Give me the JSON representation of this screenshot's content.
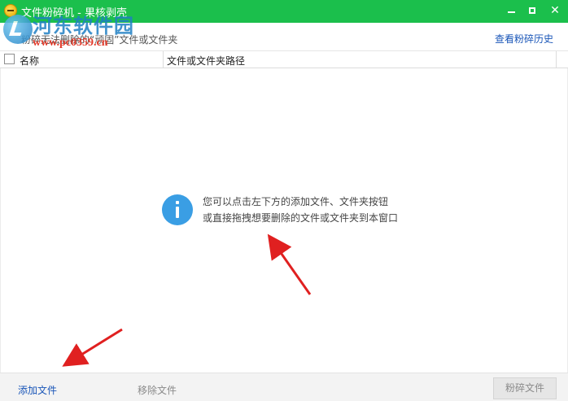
{
  "window": {
    "title": "文件粉碎机 - 果核剥壳"
  },
  "watermark": {
    "name": "河东软件园",
    "url": "www.pc0359.cn"
  },
  "infobar": {
    "text": "粉碎无法删除的“顽固”文件或文件夹",
    "history_link": "查看粉碎历史"
  },
  "table": {
    "columns": {
      "name": "名称",
      "path": "文件或文件夹路径"
    }
  },
  "hint": {
    "line1": "您可以点击左下方的添加文件、文件夹按钮",
    "line2": "或直接拖拽想要删除的文件或文件夹到本窗口"
  },
  "toolbar": {
    "add_file": "添加文件",
    "remove_file": "移除文件",
    "shred_file": "粉碎文件"
  },
  "colors": {
    "titlebar": "#1bbf4c",
    "link": "#1a56b8",
    "info_icon": "#3a9ee4",
    "annotation_arrow": "#e02020"
  },
  "icons": {
    "app": "app-logo-icon",
    "info": "info-icon",
    "minimize": "minimize-icon",
    "maximize": "maximize-icon",
    "close": "close-icon"
  }
}
